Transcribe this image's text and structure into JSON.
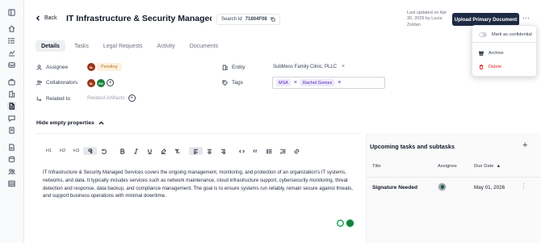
{
  "header": {
    "back_label": "Back",
    "title": "IT Infrastructure & Security Managed Services",
    "search_id_label": "Search Id",
    "search_id_value": "71804F08",
    "updated_text": "Last updated on Apr 30, 2026 by Lucia Zoldan",
    "upload_label": "Upload Primary Document",
    "more_label": "···"
  },
  "tabs": [
    {
      "label": "Details",
      "active": true
    },
    {
      "label": "Tasks",
      "active": false
    },
    {
      "label": "Legal Requests",
      "active": false
    },
    {
      "label": "Activity",
      "active": false
    },
    {
      "label": "Documents",
      "active": false
    }
  ],
  "properties": {
    "assignee_label": "Assignee",
    "assignee_initials": "SL",
    "assignee_status": "Pending",
    "collaborators_label": "Collaborators",
    "collab1_initials": "SL",
    "collab2_initials": "RG",
    "related_label": "Related to",
    "related_artifacts_label": "Related Artifacts",
    "entity_label": "Entity",
    "entity_value": "SubMess Family Clinic, PLLC",
    "tags_label": "Tags",
    "tags": [
      "MSA",
      "Rachel Gomez"
    ]
  },
  "hide_empty_label": "Hide empty properties",
  "editor": {
    "toolbar": [
      "H1",
      "H2",
      "H3"
    ],
    "body": "IT Infrastructure & Security Managed Services covers the ongoing management, monitoring, and protection of an organization's IT systems, networks, and data. It typically includes services such as network maintenance, cloud infrastructure support, cybersecurity monitoring, threat detection and response, data backup, and compliance management. The goal is to ensure systems run reliably, remain secure against threats, and support business operations with minimal downtime."
  },
  "tasks_panel": {
    "title": "Upcoming tasks and subtasks",
    "col_title": "Title",
    "col_assignee": "Assignee",
    "col_due": "Due Date",
    "rows": [
      {
        "title": "Signature Needed",
        "due": "May 01, 2026"
      }
    ]
  },
  "menu": {
    "confidential_label": "Mark as confidential",
    "archive_label": "Archive",
    "delete_label": "Delete"
  },
  "colors": {
    "primary": "#1f2a44",
    "pending_bg": "#fdf1de",
    "tag_bg": "#ede9fe",
    "danger": "#dc2626"
  }
}
